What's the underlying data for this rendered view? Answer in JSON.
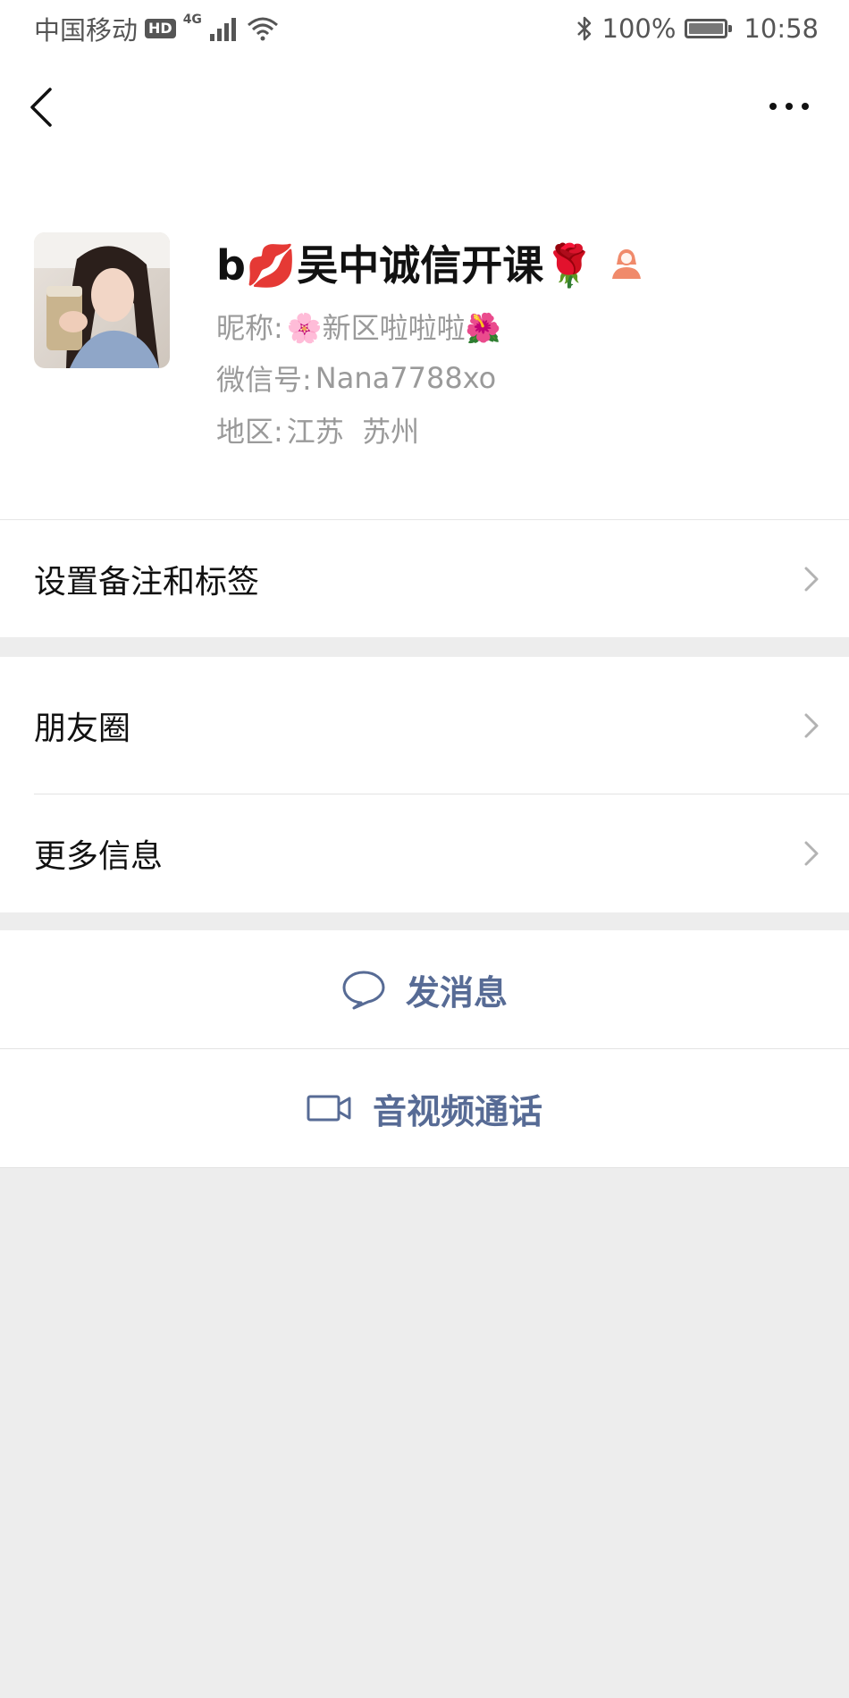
{
  "status_bar": {
    "carrier": "中国移动",
    "hd_badge": "HD",
    "network": "4G",
    "battery_level": "100%",
    "battery_fraction": 1.0,
    "time": "10:58"
  },
  "nav": {
    "back_icon": "chevron-left-icon",
    "more_icon": "more-dots-icon"
  },
  "profile": {
    "display_name": "b💋吴中诚信开课🌹",
    "gender_icon": "female-user-icon",
    "nickname_label": "昵称:",
    "nickname_value": "🌸新区啦啦啦🌺",
    "wechat_id_label": "微信号:",
    "wechat_id_value": "Nana7788xo",
    "region_label": "地区:",
    "region_value": "江苏  苏州"
  },
  "menu": {
    "remarks_tags": "设置备注和标签",
    "moments": "朋友圈",
    "more_info": "更多信息"
  },
  "actions": {
    "send_message": "发消息",
    "av_call": "音视频通话"
  },
  "colors": {
    "link_blue": "#576b95",
    "background": "#ededed",
    "secondary_text": "#9a9a9a",
    "female_icon": "#f08a6b"
  }
}
